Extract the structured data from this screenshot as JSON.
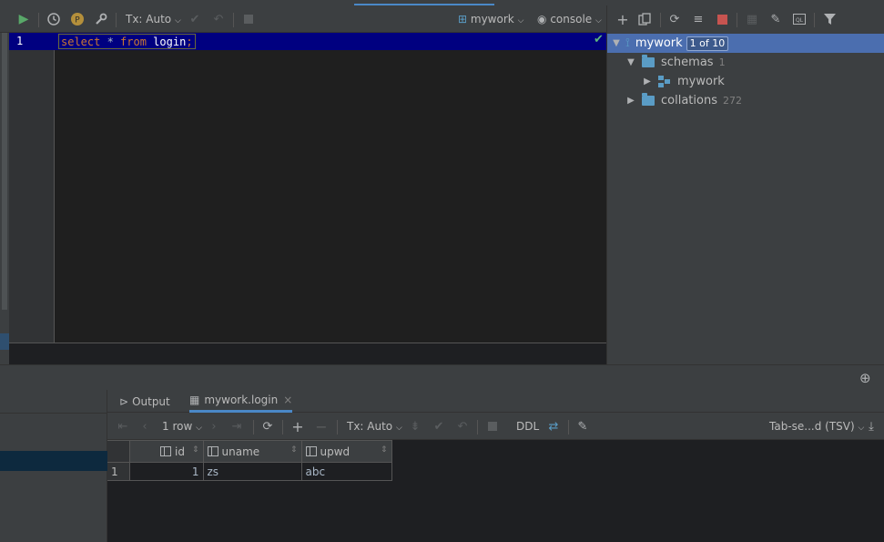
{
  "editor": {
    "toolbar": {
      "tx_mode": "Tx: Auto",
      "datasource": "mywork",
      "session": "console"
    },
    "lines": [
      {
        "number": "1",
        "tokens": [
          "select",
          " * ",
          "from",
          " login",
          ";"
        ]
      }
    ]
  },
  "database_panel": {
    "tree": {
      "root": {
        "label": "mywork",
        "badge": "1 of 10"
      },
      "schemas": {
        "label": "schemas",
        "count": "1"
      },
      "schema_item": {
        "label": "mywork"
      },
      "collations": {
        "label": "collations",
        "count": "272"
      }
    }
  },
  "results": {
    "tabs": [
      {
        "label": "Output"
      },
      {
        "label": "mywork.login"
      }
    ],
    "toolbar": {
      "rows": "1 row",
      "tx_mode": "Tx: Auto",
      "ddl": "DDL",
      "export_format": "Tab-se...d (TSV)"
    },
    "grid": {
      "columns": [
        "id",
        "uname",
        "upwd"
      ],
      "rows": [
        {
          "row_number": "1",
          "id": "1",
          "uname": "zs",
          "upwd": "abc"
        }
      ]
    }
  },
  "colors": {
    "background": "#2b2d30",
    "selection": "#4b6eaf",
    "current_line": "#000080",
    "keyword": "#cc7832",
    "run_green": "#59a869",
    "stop_red": "#c75450"
  }
}
